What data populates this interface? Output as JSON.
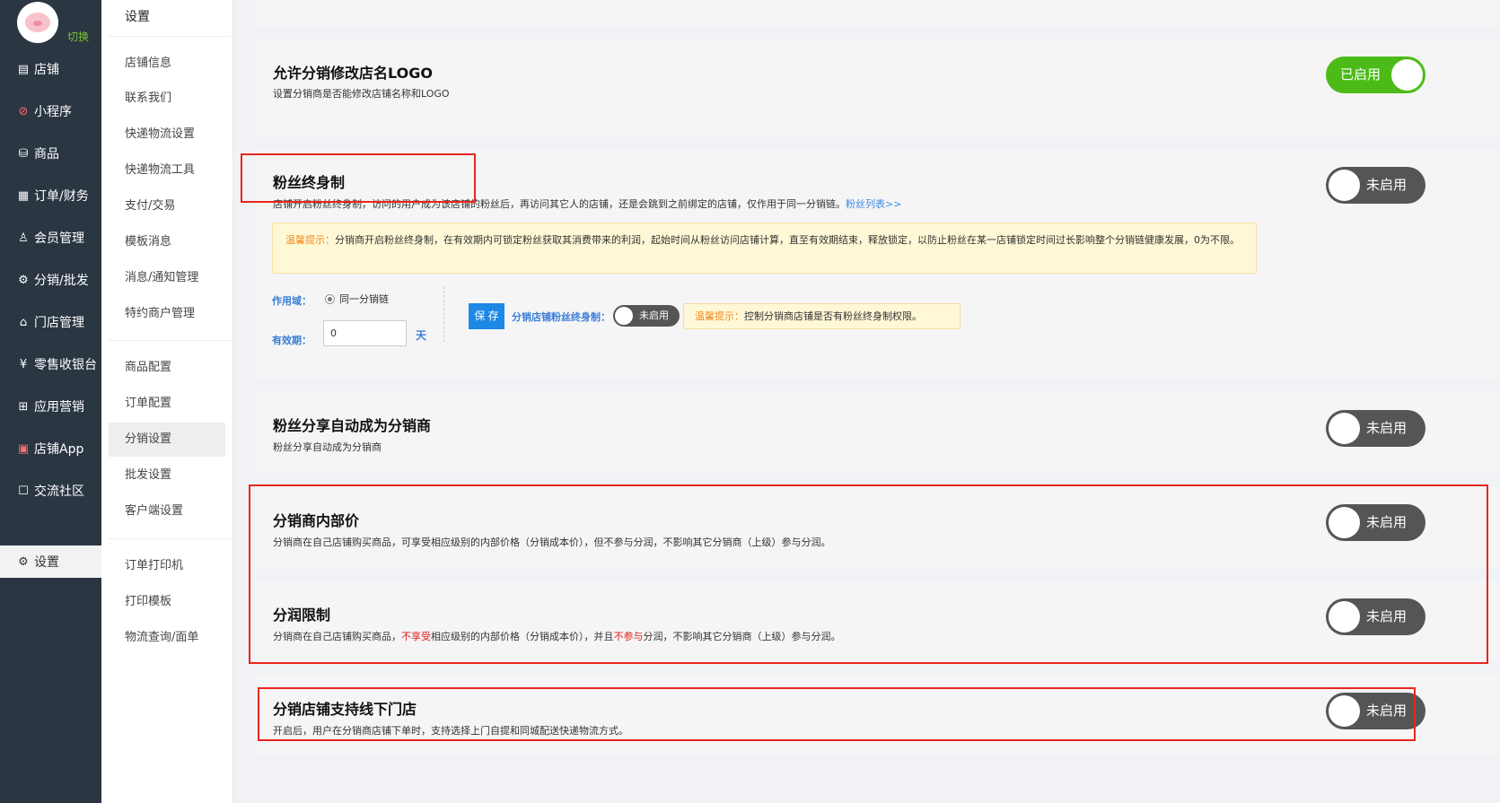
{
  "nav": {
    "switch_label": "切换",
    "items": [
      {
        "label": "店铺",
        "icon": "store-icon"
      },
      {
        "label": "小程序",
        "icon": "miniprogram-icon"
      },
      {
        "label": "商品",
        "icon": "product-icon"
      },
      {
        "label": "订单/财务",
        "icon": "order-icon"
      },
      {
        "label": "会员管理",
        "icon": "member-icon"
      },
      {
        "label": "分销/批发",
        "icon": "distribution-icon"
      },
      {
        "label": "门店管理",
        "icon": "shop-icon"
      },
      {
        "label": "零售收银台",
        "icon": "cashier-icon"
      },
      {
        "label": "应用营销",
        "icon": "apps-icon"
      },
      {
        "label": "店铺App",
        "icon": "app-icon"
      },
      {
        "label": "交流社区",
        "icon": "community-icon"
      },
      {
        "label": "设置",
        "icon": "gear-icon"
      }
    ]
  },
  "submenu": {
    "title": "设置",
    "items": [
      "店铺信息",
      "联系我们",
      "快递物流设置",
      "快递物流工具",
      "支付/交易",
      "模板消息",
      "消息/通知管理",
      "特约商户管理",
      "商品配置",
      "订单配置",
      "分销设置",
      "批发设置",
      "客户端设置",
      "订单打印机",
      "打印模板",
      "物流查询/面单"
    ]
  },
  "settings": {
    "logo": {
      "title": "允许分销修改店名LOGO",
      "desc": "设置分销商是否能修改店铺名称和LOGO",
      "toggle": "已启用"
    },
    "fans": {
      "title": "粉丝终身制",
      "desc": "店铺开启粉丝终身制，访问的用户成为该店铺的粉丝后，再访问其它人的店铺，还是会跳到之前绑定的店铺，仅作用于同一分销链。",
      "link": "粉丝列表>>",
      "toggle": "未启用",
      "tip_label": "温馨提示：",
      "tip_text": "分销商开启粉丝终身制，在有效期内可锁定粉丝获取其消费带来的利润，起始时间从粉丝访问店铺计算，直至有效期结束，释放锁定，以防止粉丝在某一店铺锁定时间过长影响整个分销链健康发展，0为不限。",
      "scope_label": "作用域：",
      "scope_option": "同一分销链",
      "valid_label": "有效期：",
      "valid_value": "0",
      "valid_unit": "天",
      "save_label": "保 存",
      "store_fans_label": "分销店铺粉丝终身制：",
      "store_fans_toggle": "未启用",
      "store_tip_label": "温馨提示：",
      "store_tip_text": "控制分销商店铺是否有粉丝终身制权限。"
    },
    "share": {
      "title": "粉丝分享自动成为分销商",
      "desc": "粉丝分享自动成为分销商",
      "toggle": "未启用"
    },
    "inner_price": {
      "title": "分销商内部价",
      "desc": "分销商在自己店铺购买商品，可享受相应级别的内部价格（分销成本价），但不参与分润，不影响其它分销商（上级）参与分润。",
      "toggle": "未启用"
    },
    "profit_limit": {
      "title": "分润限制",
      "desc_a": "分销商在自己店铺购买商品，",
      "desc_b": "不享受",
      "desc_c": "相应级别的内部价格（分销成本价），并且",
      "desc_d": "不参与",
      "desc_e": "分润，不影响其它分销商（上级）参与分润。",
      "toggle": "未启用"
    },
    "offline": {
      "title": "分销店铺支持线下门店",
      "desc": "开启后，用户在分销商店铺下单时，支持选择上门自提和同城配送快递物流方式。",
      "toggle": "未启用"
    }
  }
}
